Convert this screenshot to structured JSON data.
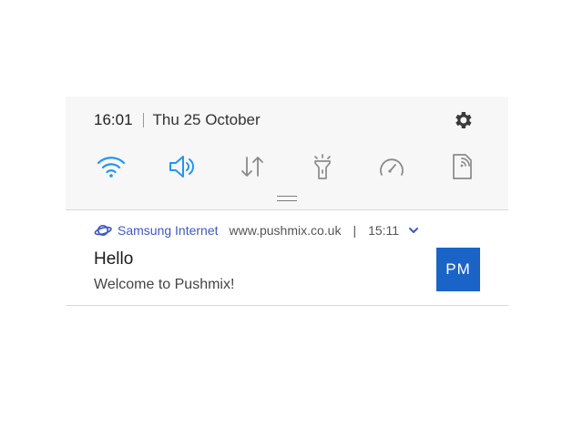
{
  "status_bar": {
    "time": "16:01",
    "date": "Thu 25 October",
    "settings_icon": "gear-icon"
  },
  "quick_toggles": [
    {
      "id": "wifi",
      "icon": "wifi-icon",
      "active": true,
      "color": "#2196f3"
    },
    {
      "id": "sound",
      "icon": "speaker-icon",
      "active": true,
      "color": "#2196f3"
    },
    {
      "id": "mobile-data",
      "icon": "data-arrows-icon",
      "active": false,
      "color": "#8a8a8a"
    },
    {
      "id": "flashlight",
      "icon": "flashlight-icon",
      "active": false,
      "color": "#8a8a8a"
    },
    {
      "id": "power-mode",
      "icon": "gauge-icon",
      "active": false,
      "color": "#8a8a8a"
    },
    {
      "id": "nfc",
      "icon": "nfc-icon",
      "active": false,
      "color": "#8a8a8a"
    }
  ],
  "notification": {
    "app_icon": "planet-icon",
    "app_name": "Samsung Internet",
    "url": "www.pushmix.co.uk",
    "separator": "|",
    "time": "15:11",
    "title": "Hello",
    "body": "Welcome to Pushmix!",
    "avatar_text": "PM",
    "avatar_color": "#1a64c8",
    "accent_color": "#3e58c9"
  }
}
